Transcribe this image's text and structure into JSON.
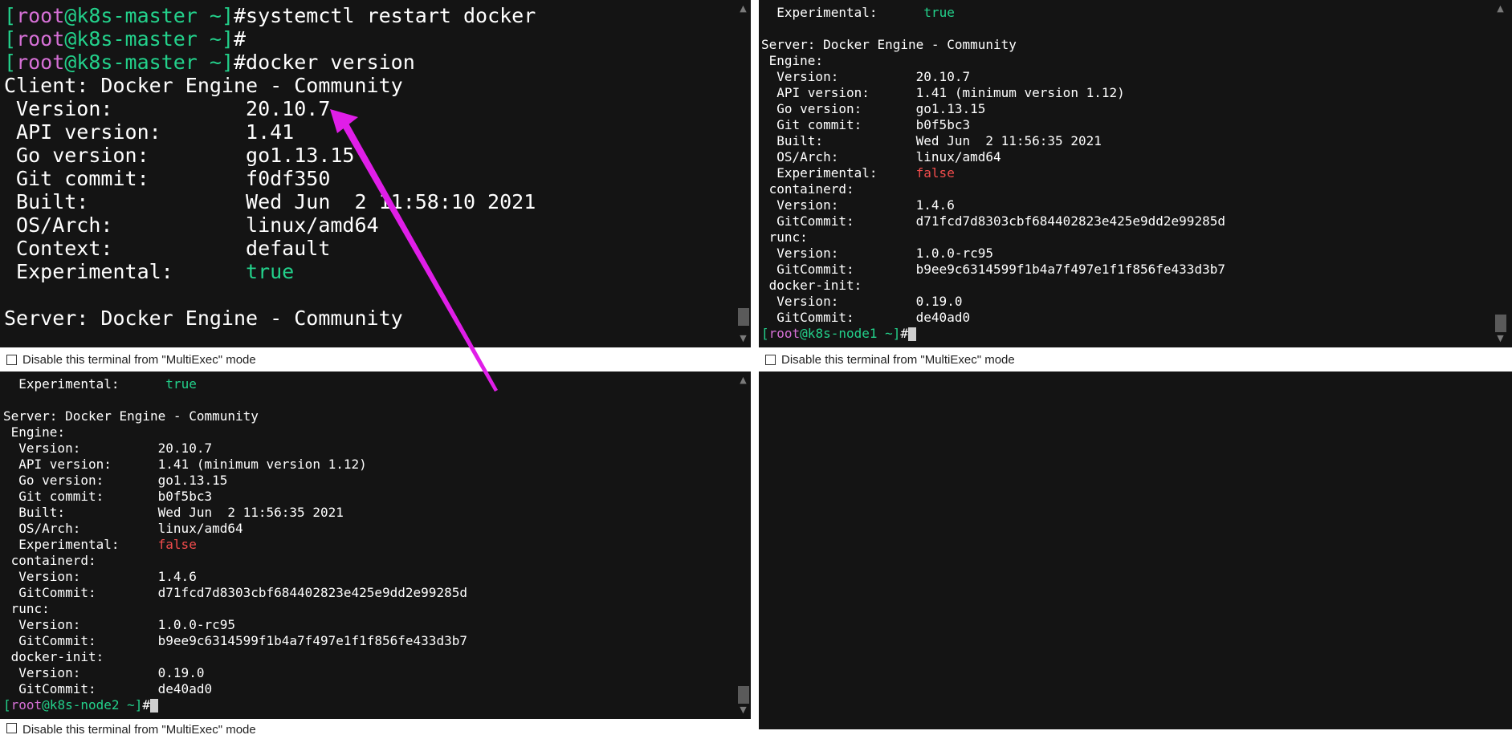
{
  "panes": {
    "master": {
      "lines": [
        [
          {
            "t": "[",
            "c": "g"
          },
          {
            "t": "root",
            "c": "m"
          },
          {
            "t": "@k8s-master ~]",
            "c": "g"
          },
          {
            "t": "#systemctl restart docker",
            "c": "w"
          }
        ],
        [
          {
            "t": "[",
            "c": "g"
          },
          {
            "t": "root",
            "c": "m"
          },
          {
            "t": "@k8s-master ~]",
            "c": "g"
          },
          {
            "t": "#",
            "c": "w"
          }
        ],
        [
          {
            "t": "[",
            "c": "g"
          },
          {
            "t": "root",
            "c": "m"
          },
          {
            "t": "@k8s-master ~]",
            "c": "g"
          },
          {
            "t": "#docker version",
            "c": "w"
          }
        ],
        [
          {
            "t": "Client: Docker Engine - Community",
            "c": "w"
          }
        ],
        [
          {
            "t": " Version:           20.10.7",
            "c": "w"
          }
        ],
        [
          {
            "t": " API version:       1.41",
            "c": "w"
          }
        ],
        [
          {
            "t": " Go version:        go1.13.15",
            "c": "w"
          }
        ],
        [
          {
            "t": " Git commit:        f0df350",
            "c": "w"
          }
        ],
        [
          {
            "t": " Built:             Wed Jun  2 11:58:10 2021",
            "c": "w"
          }
        ],
        [
          {
            "t": " OS/Arch:           linux/amd64",
            "c": "w"
          }
        ],
        [
          {
            "t": " Context:           default",
            "c": "w"
          }
        ],
        [
          {
            "t": " Experimental:      ",
            "c": "w"
          },
          {
            "t": "true",
            "c": "g"
          }
        ],
        [
          {
            "t": "",
            "c": "w"
          }
        ],
        [
          {
            "t": "Server: Docker Engine - Community",
            "c": "w"
          }
        ]
      ]
    },
    "node1": {
      "lines": [
        [
          {
            "t": "  Experimental:      ",
            "c": "w"
          },
          {
            "t": "true",
            "c": "g"
          }
        ],
        [
          {
            "t": "",
            "c": "w"
          }
        ],
        [
          {
            "t": "Server: Docker Engine - Community",
            "c": "w"
          }
        ],
        [
          {
            "t": " Engine:",
            "c": "w"
          }
        ],
        [
          {
            "t": "  Version:          20.10.7",
            "c": "w"
          }
        ],
        [
          {
            "t": "  API version:      1.41 (minimum version 1.12)",
            "c": "w"
          }
        ],
        [
          {
            "t": "  Go version:       go1.13.15",
            "c": "w"
          }
        ],
        [
          {
            "t": "  Git commit:       b0f5bc3",
            "c": "w"
          }
        ],
        [
          {
            "t": "  Built:            Wed Jun  2 11:56:35 2021",
            "c": "w"
          }
        ],
        [
          {
            "t": "  OS/Arch:          linux/amd64",
            "c": "w"
          }
        ],
        [
          {
            "t": "  Experimental:     ",
            "c": "w"
          },
          {
            "t": "false",
            "c": "r"
          }
        ],
        [
          {
            "t": " containerd:",
            "c": "w"
          }
        ],
        [
          {
            "t": "  Version:          1.4.6",
            "c": "w"
          }
        ],
        [
          {
            "t": "  GitCommit:        d71fcd7d8303cbf684402823e425e9dd2e99285d",
            "c": "w"
          }
        ],
        [
          {
            "t": " runc:",
            "c": "w"
          }
        ],
        [
          {
            "t": "  Version:          1.0.0-rc95",
            "c": "w"
          }
        ],
        [
          {
            "t": "  GitCommit:        b9ee9c6314599f1b4a7f497e1f1f856fe433d3b7",
            "c": "w"
          }
        ],
        [
          {
            "t": " docker-init:",
            "c": "w"
          }
        ],
        [
          {
            "t": "  Version:          0.19.0",
            "c": "w"
          }
        ],
        [
          {
            "t": "  GitCommit:        de40ad0",
            "c": "w"
          }
        ],
        [
          {
            "t": "[",
            "c": "g"
          },
          {
            "t": "root",
            "c": "m"
          },
          {
            "t": "@k8s-node1 ~]",
            "c": "g"
          },
          {
            "t": "#",
            "c": "w"
          }
        ]
      ]
    },
    "node2": {
      "lines": [
        [
          {
            "t": "  Experimental:      ",
            "c": "w"
          },
          {
            "t": "true",
            "c": "g"
          }
        ],
        [
          {
            "t": "",
            "c": "w"
          }
        ],
        [
          {
            "t": "Server: Docker Engine - Community",
            "c": "w"
          }
        ],
        [
          {
            "t": " Engine:",
            "c": "w"
          }
        ],
        [
          {
            "t": "  Version:          20.10.7",
            "c": "w"
          }
        ],
        [
          {
            "t": "  API version:      1.41 (minimum version 1.12)",
            "c": "w"
          }
        ],
        [
          {
            "t": "  Go version:       go1.13.15",
            "c": "w"
          }
        ],
        [
          {
            "t": "  Git commit:       b0f5bc3",
            "c": "w"
          }
        ],
        [
          {
            "t": "  Built:            Wed Jun  2 11:56:35 2021",
            "c": "w"
          }
        ],
        [
          {
            "t": "  OS/Arch:          linux/amd64",
            "c": "w"
          }
        ],
        [
          {
            "t": "  Experimental:     ",
            "c": "w"
          },
          {
            "t": "false",
            "c": "r"
          }
        ],
        [
          {
            "t": " containerd:",
            "c": "w"
          }
        ],
        [
          {
            "t": "  Version:          1.4.6",
            "c": "w"
          }
        ],
        [
          {
            "t": "  GitCommit:        d71fcd7d8303cbf684402823e425e9dd2e99285d",
            "c": "w"
          }
        ],
        [
          {
            "t": " runc:",
            "c": "w"
          }
        ],
        [
          {
            "t": "  Version:          1.0.0-rc95",
            "c": "w"
          }
        ],
        [
          {
            "t": "  GitCommit:        b9ee9c6314599f1b4a7f497e1f1f856fe433d3b7",
            "c": "w"
          }
        ],
        [
          {
            "t": " docker-init:",
            "c": "w"
          }
        ],
        [
          {
            "t": "  Version:          0.19.0",
            "c": "w"
          }
        ],
        [
          {
            "t": "  GitCommit:        de40ad0",
            "c": "w"
          }
        ],
        [
          {
            "t": "[",
            "c": "g"
          },
          {
            "t": "root",
            "c": "m"
          },
          {
            "t": "@k8s-node2 ~]",
            "c": "g"
          },
          {
            "t": "#",
            "c": "w"
          }
        ]
      ]
    }
  },
  "multiexec": {
    "label": "Disable this terminal from \"MultiExec\" mode"
  },
  "colors": {
    "terminal_bg": "#141414",
    "prompt_green": "#23d18b",
    "user_magenta": "#d670d6",
    "false_red": "#f14c4c",
    "annotation_arrow": "#e01ee8"
  }
}
